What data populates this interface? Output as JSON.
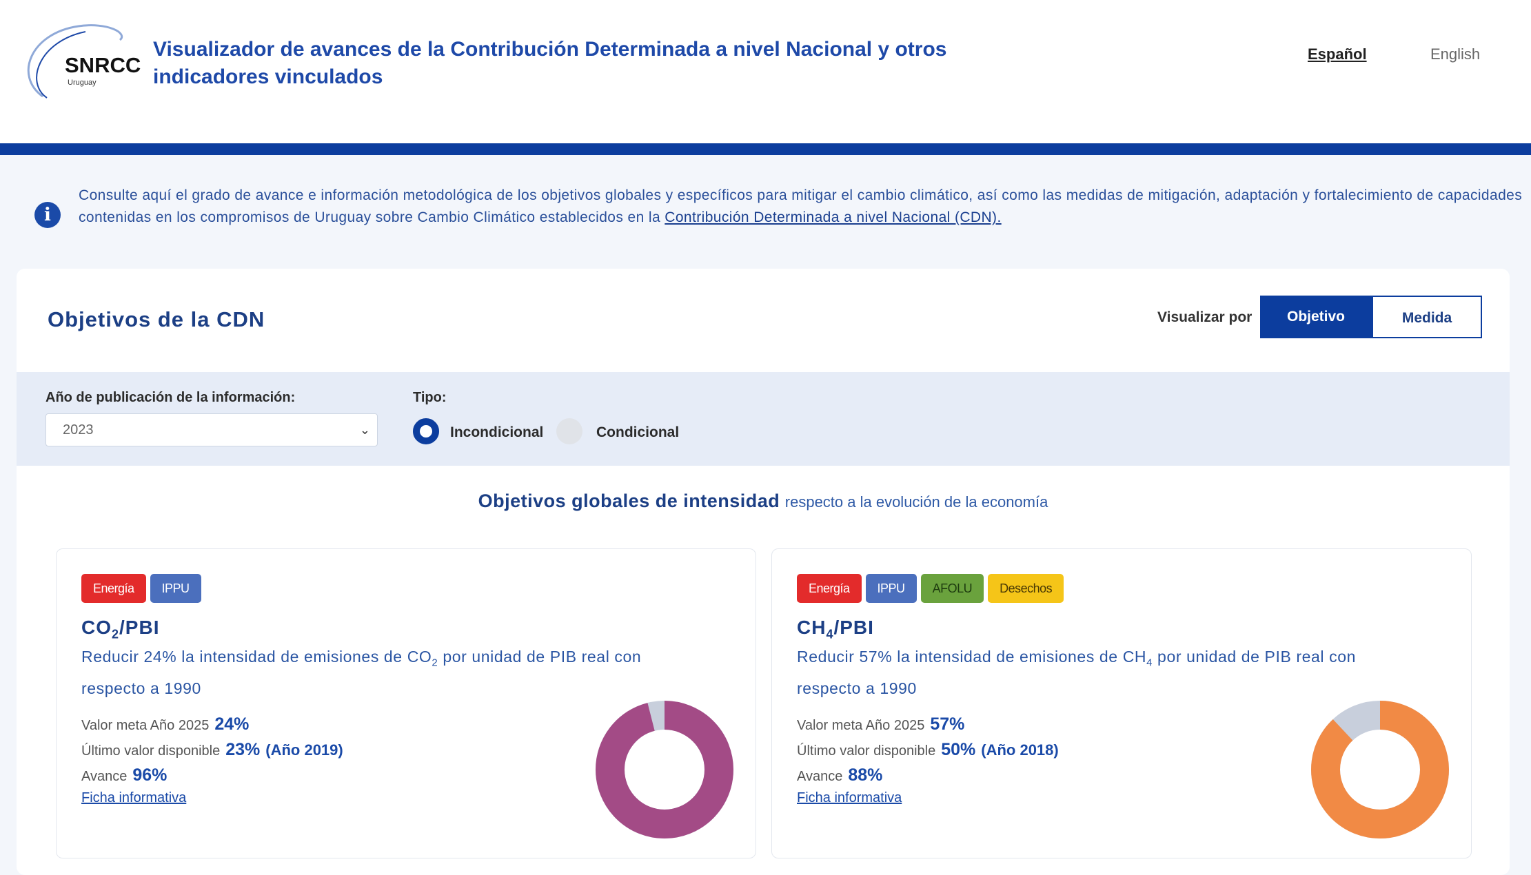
{
  "header": {
    "logo_text": "SNRCC",
    "logo_subtext": "Uruguay",
    "title": "Visualizador de avances de la Contribución Determinada a nivel Nacional y otros indicadores vinculados",
    "lang_es": "Español",
    "lang_en": "English"
  },
  "info": {
    "text": "Consulte aquí el grado de avance e información metodológica de los objetivos globales y específicos para mitigar el cambio climático, así como las medidas de mitigación, adaptación y fortalecimiento de capacidades contenidas en los compromisos de Uruguay sobre Cambio Climático establecidos en la ",
    "link": "Contribución Determinada a nivel Nacional (CDN)."
  },
  "main": {
    "title": "Objetivos de la CDN",
    "visualize_label": "Visualizar por",
    "toggle_objetivo": "Objetivo",
    "toggle_medida": "Medida",
    "filters": {
      "year_label": "Año de publicación de la información:",
      "year_value": "2023",
      "type_label": "Tipo:",
      "type_options": [
        "Incondicional",
        "Condicional"
      ],
      "type_selected": "Incondicional"
    },
    "section_title_strong": "Objetivos globales de intensidad",
    "section_title_light": "respecto a la evolución de la economía"
  },
  "labels": {
    "meta": "Valor meta Año 2025",
    "ultimo": "Último valor disponible",
    "avance": "Avance",
    "ficha": "Ficha informativa"
  },
  "colors": {
    "energia": "#e32b2b",
    "ippu": "#4b6fbd",
    "afolu": "#6aa23d",
    "desechos": "#f5c518",
    "co2_donut": "#a34b86",
    "ch4_donut": "#f18a45",
    "donut_rest": "#c8cfdc"
  },
  "objectives": [
    {
      "tags": [
        "Energía",
        "IPPU"
      ],
      "name_base": "CO",
      "name_sub": "2",
      "name_tail": "/PBI",
      "desc_pre": "Reducir 24% la intensidad de emisiones de CO",
      "desc_sub": "2",
      "desc_post": " por unidad de PIB real con respecto a 1990",
      "meta": "24%",
      "ultimo": "23%",
      "ultimo_year": "(Año 2019)",
      "avance": "96%",
      "avance_fraction": 0.96
    },
    {
      "tags": [
        "Energía",
        "IPPU",
        "AFOLU",
        "Desechos"
      ],
      "name_base": "CH",
      "name_sub": "4",
      "name_tail": "/PBI",
      "desc_pre": "Reducir 57% la intensidad de emisiones de CH",
      "desc_sub": "4",
      "desc_post": " por unidad de PIB real con respecto a 1990",
      "meta": "57%",
      "ultimo": "50%",
      "ultimo_year": "(Año 2018)",
      "avance": "88%",
      "avance_fraction": 0.88
    }
  ]
}
